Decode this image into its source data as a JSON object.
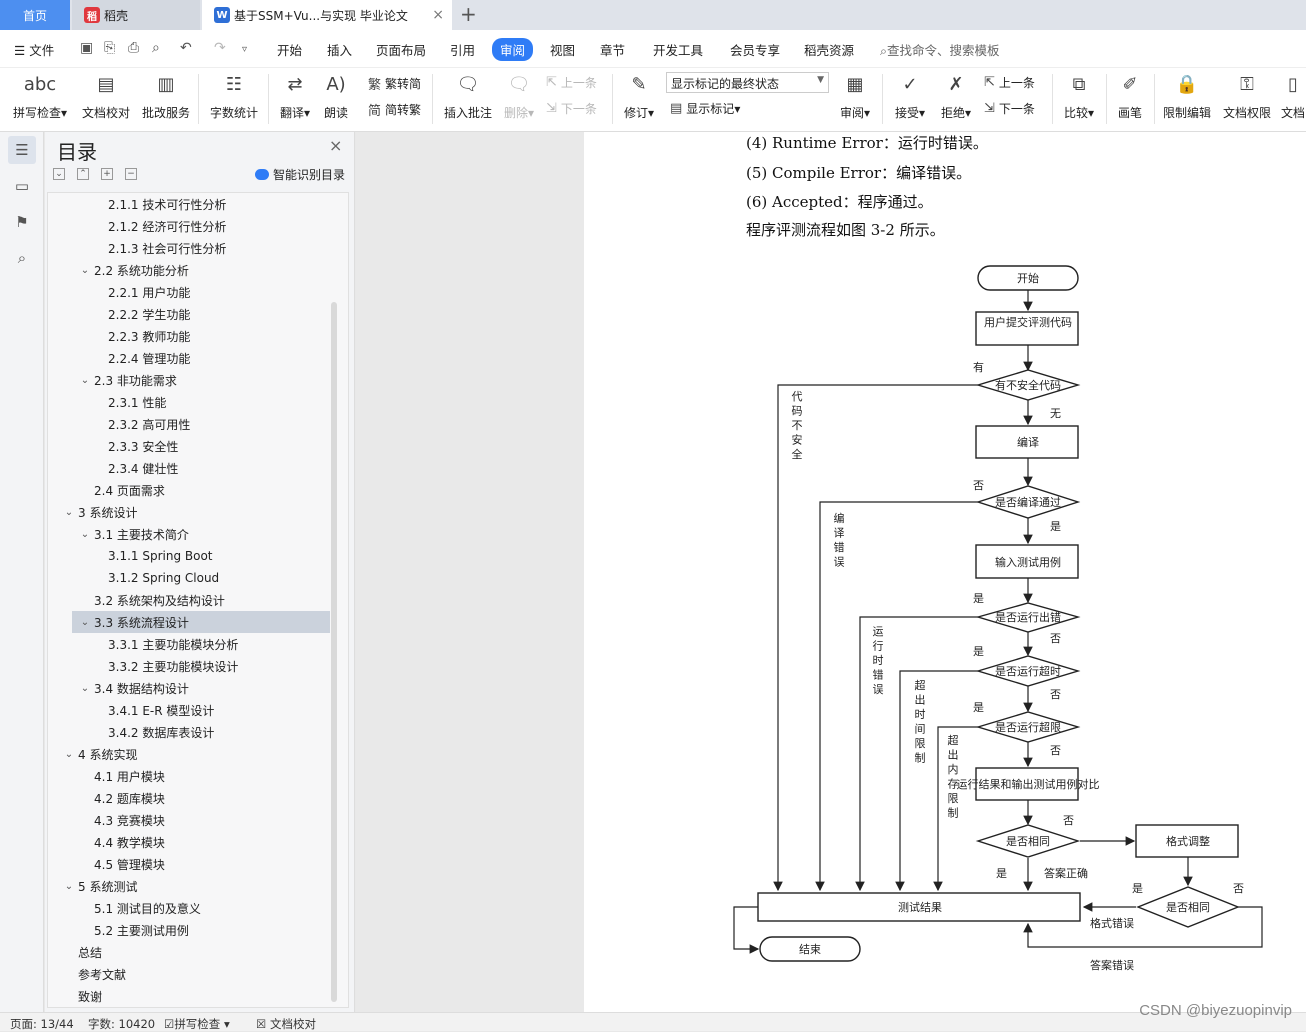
{
  "tabs": {
    "home": "首页",
    "daoke": "稻壳",
    "doc": "基于SSM+Vu...与实现 毕业论文"
  },
  "menu": {
    "file": "文件",
    "items": [
      "开始",
      "插入",
      "页面布局",
      "引用",
      "审阅",
      "视图",
      "章节",
      "开发工具",
      "会员专享",
      "稻壳资源"
    ],
    "active": "审阅",
    "search": "查找命令、搜索模板"
  },
  "ribbon": {
    "spell": "拼写检查",
    "proofread": "文档校对",
    "batch": "批改服务",
    "wordcount": "字数统计",
    "translate": "翻译",
    "read": "朗读",
    "trad": "繁转简",
    "simp": "简转繁",
    "insert_comment": "插入批注",
    "delete": "删除",
    "prev": "上一条",
    "next": "下一条",
    "revise": "修订",
    "display_state": "显示标记的最终状态",
    "show_marks": "显示标记",
    "review": "审阅",
    "accept": "接受",
    "reject": "拒绝",
    "prev2": "上一条",
    "next2": "下一条",
    "compare": "比较",
    "pen": "画笔",
    "restrict": "限制编辑",
    "rights": "文档权限",
    "more": "文档"
  },
  "toc": {
    "title": "目录",
    "smart": "智能识别目录",
    "items": [
      {
        "label": "2.1.1 技术可行性分析",
        "level": 3
      },
      {
        "label": "2.1.2 经济可行性分析",
        "level": 3
      },
      {
        "label": "2.1.3 社会可行性分析",
        "level": 3
      },
      {
        "label": "2.2 系统功能分析",
        "level": 2,
        "expand": true
      },
      {
        "label": "2.2.1 用户功能",
        "level": 3
      },
      {
        "label": "2.2.2 学生功能",
        "level": 3
      },
      {
        "label": "2.2.3 教师功能",
        "level": 3
      },
      {
        "label": "2.2.4 管理功能",
        "level": 3
      },
      {
        "label": "2.3 非功能需求",
        "level": 2,
        "expand": true
      },
      {
        "label": "2.3.1 性能",
        "level": 3
      },
      {
        "label": "2.3.2 高可用性",
        "level": 3
      },
      {
        "label": "2.3.3 安全性",
        "level": 3
      },
      {
        "label": "2.3.4 健壮性",
        "level": 3
      },
      {
        "label": "2.4 页面需求",
        "level": 2
      },
      {
        "label": "3  系统设计",
        "level": 1,
        "expand": true
      },
      {
        "label": "3.1 主要技术简介",
        "level": 2,
        "expand": true
      },
      {
        "label": "3.1.1 Spring Boot",
        "level": 3
      },
      {
        "label": "3.1.2 Spring Cloud",
        "level": 3
      },
      {
        "label": "3.2 系统架构及结构设计",
        "level": 2
      },
      {
        "label": "3.3 系统流程设计",
        "level": 2,
        "expand": true,
        "selected": true
      },
      {
        "label": "3.3.1 主要功能模块分析",
        "level": 3
      },
      {
        "label": "3.3.2 主要功能模块设计",
        "level": 3
      },
      {
        "label": "3.4 数据结构设计",
        "level": 2,
        "expand": true
      },
      {
        "label": "3.4.1 E-R 模型设计",
        "level": 3
      },
      {
        "label": "3.4.2 数据库表设计",
        "level": 3
      },
      {
        "label": "4  系统实现",
        "level": 1,
        "expand": true
      },
      {
        "label": "4.1 用户模块",
        "level": 2
      },
      {
        "label": "4.2 题库模块",
        "level": 2
      },
      {
        "label": "4.3 竞赛模块",
        "level": 2
      },
      {
        "label": "4.4 教学模块",
        "level": 2
      },
      {
        "label": "4.5 管理模块",
        "level": 2
      },
      {
        "label": "5  系统测试",
        "level": 1,
        "expand": true
      },
      {
        "label": "5.1 测试目的及意义",
        "level": 2
      },
      {
        "label": "5.2 主要测试用例",
        "level": 2
      },
      {
        "label": "总结",
        "level": 1
      },
      {
        "label": "参考文献",
        "level": 1
      },
      {
        "label": "致谢",
        "level": 1
      }
    ]
  },
  "document": {
    "lines": [
      "(4) Runtime Error：运行时错误。",
      "(5) Compile Error：编译错误。",
      "(6) Accepted：程序通过。",
      "程序评测流程如图 3-2 所示。"
    ]
  },
  "flowchart": {
    "start": "开始",
    "submit": "用户提交评测代码",
    "unsafe_q": "有不安全代码",
    "has": "有",
    "none": "无",
    "unsafe_side": "代码不安全",
    "compile": "编译",
    "no": "否",
    "yes": "是",
    "compile_q": "是否编译通过",
    "compile_err": "编译错误",
    "input": "输入测试用例",
    "runerr_q": "是否运行出错",
    "runerr_side": "运行时错误",
    "timeout_q": "是否运行超时",
    "time_side": "超出时间限制",
    "memory_q": "是否运行超限",
    "mem_side": "超出内存限制",
    "compare": "运行结果和输出测试用例对比",
    "same_q": "是否相同",
    "format_adjust": "格式调整",
    "answer_correct": "答案正确",
    "result": "测试结果",
    "same_q2": "是否相同",
    "format_err": "格式错误",
    "end": "结束",
    "answer_wrong": "答案错误"
  },
  "status": {
    "page": "页面: 13/44",
    "words": "字数: 10420",
    "spell": "拼写检查",
    "proof": "文档校对"
  },
  "watermark": "CSDN @biyezuopinvip",
  "colors": {
    "accent": "#2f7cf6",
    "home_tab": "#4d8ff0"
  }
}
